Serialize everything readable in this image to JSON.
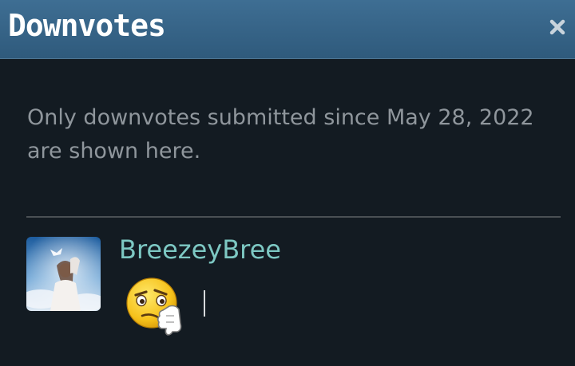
{
  "dialog": {
    "title": "Downvotes",
    "close_label": "×"
  },
  "notice": {
    "text": "Only downvotes submitted since May 28, 2022 are shown here."
  },
  "entries": [
    {
      "username": "BreezeyBree",
      "avatar_icon": "user-avatar-photo",
      "reaction_icon": "thinking-thumbs-down-emoji-icon"
    }
  ],
  "colors": {
    "titlebar": "#3a6a8f",
    "background": "#131b22",
    "notice_text": "#8f969c",
    "username": "#7dc8c3",
    "divider": "#4a5054"
  }
}
